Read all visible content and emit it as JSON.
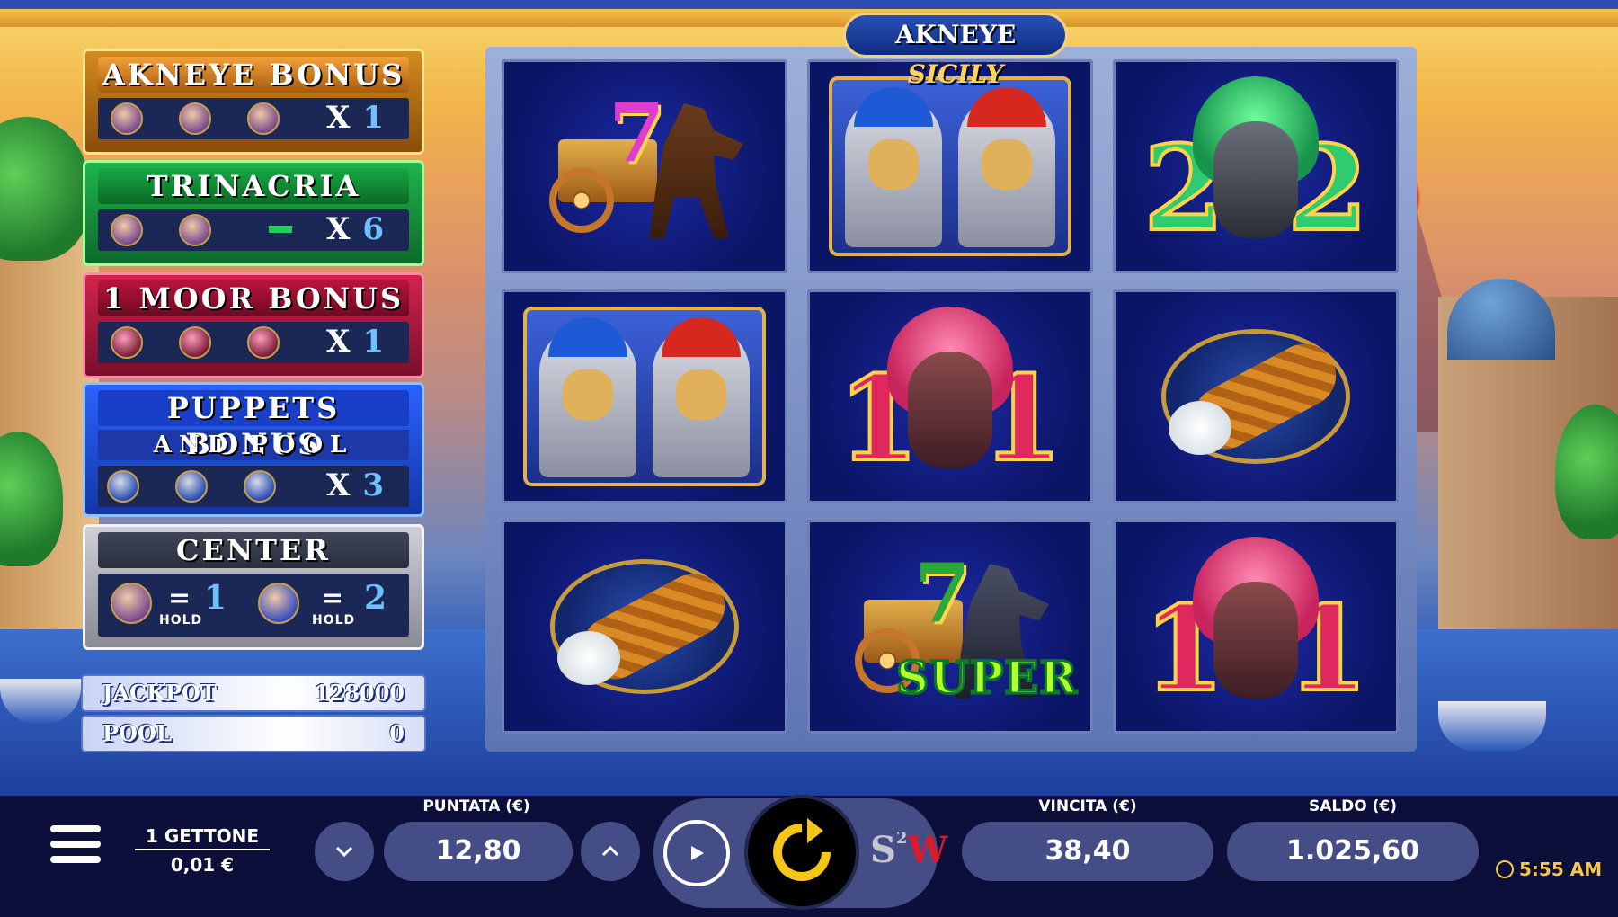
{
  "game": {
    "logo_part1": "AKNEYE",
    "logo_part2": "SICILY"
  },
  "bonus_panels": {
    "akneye": {
      "title": "AKNEYE BONUS",
      "mult_x": "X",
      "mult_value": "1"
    },
    "trinacria": {
      "title": "TRINACRIA BONUS",
      "mult_x": "X",
      "mult_value": "6"
    },
    "moor": {
      "title": "1 MOOR BONUS",
      "mult_x": "X",
      "mult_value": "1"
    },
    "puppets": {
      "title": "PUPPETS BONUS",
      "subtitle": "AND POOL TAKE",
      "mult_x": "X",
      "mult_value": "3"
    },
    "center": {
      "title": "CENTER TRINACRIA",
      "eq1": "=",
      "value1": "1",
      "hold1": "HOLD",
      "eq2": "=",
      "value2": "2",
      "hold2": "HOLD"
    }
  },
  "meters": {
    "jackpot_label": "JACKPOT",
    "jackpot_value": "128000",
    "pool_label": "POOL",
    "pool_value": "0"
  },
  "reels": [
    [
      "cart-7-icon",
      "puppets-icon",
      "green-moor-2-icon"
    ],
    [
      "puppets-icon",
      "pink-moor-1-icon",
      "cannolo-icon"
    ],
    [
      "cannolo-icon",
      "super-cart-icon",
      "pink-moor-1-icon"
    ]
  ],
  "symbol_text": {
    "green_num": "2",
    "pink_num": "1",
    "super": "SUPER",
    "seven": "7"
  },
  "bottom": {
    "coin_label": "1 GETTONE",
    "coin_value": "0,01 €",
    "bet_label": "PUNTATA (€)",
    "bet_value": "12,80",
    "win_label": "VINCITA (€)",
    "win_value": "38,40",
    "balance_label": "SALDO (€)",
    "balance_value": "1.025,60",
    "s2w_s": "S",
    "s2w_sup": "2",
    "s2w_w": "W",
    "time": "5:55 AM"
  },
  "colors": {
    "spin_accent": "#f5c518",
    "pill_bg": "#444d86",
    "background": "#0b0f3a"
  }
}
